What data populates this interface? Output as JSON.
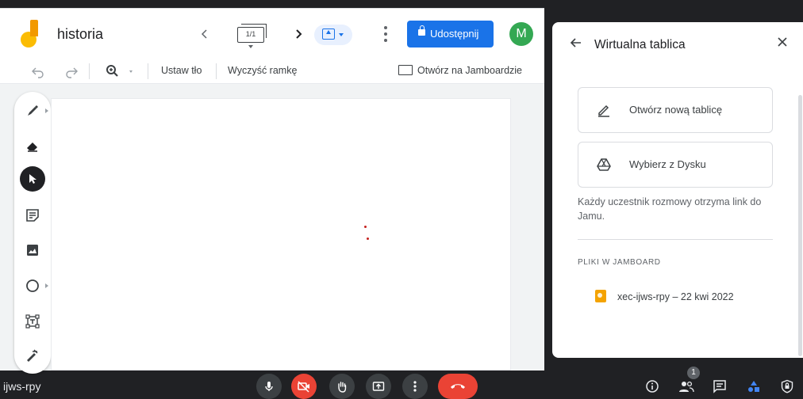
{
  "jamboard": {
    "title": "historia",
    "frame_counter": "1/1",
    "share_label": "Udostępnij",
    "avatar_initial": "M",
    "toolbar": {
      "set_background": "Ustaw tło",
      "clear_frame": "Wyczyść ramkę",
      "open_in_jamboard": "Otwórz na Jamboardzie"
    },
    "tools": [
      "pen-icon",
      "eraser-icon",
      "select-icon",
      "sticky-note-icon",
      "image-icon",
      "circle-icon",
      "text-box-icon",
      "laser-icon"
    ],
    "active_tool": "select-icon"
  },
  "panel": {
    "title": "Wirtualna tablica",
    "new_board": "Otwórz nową tablicę",
    "from_drive": "Wybierz z Dysku",
    "note": "Każdy uczestnik rozmowy otrzyma link do Jamu.",
    "section_label": "PLIKI W JAMBOARD",
    "file_name": "xec-ijws-rpy – 22 kwi 2022"
  },
  "meet": {
    "meeting_code": "ijws-rpy",
    "participants_badge": "1"
  },
  "colors": {
    "share_blue": "#1a73e8",
    "avatar_green": "#34a853",
    "end_call_red": "#ea4335",
    "meet_bg": "#202124"
  }
}
